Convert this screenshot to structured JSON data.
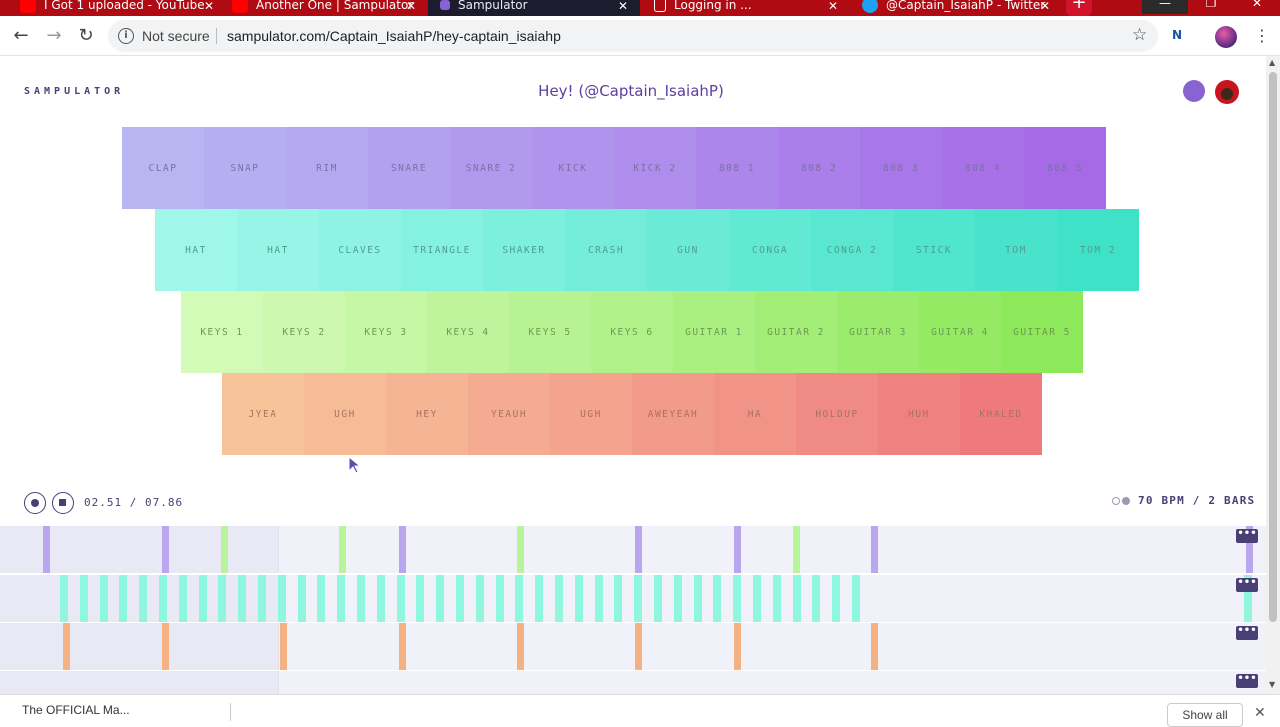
{
  "browser": {
    "tabs": [
      {
        "title": "I Got 1 uploaded - YouTube",
        "favicon_color": "#ff0000"
      },
      {
        "title": "Another One | Sampulator",
        "favicon_color": "#ff0000"
      },
      {
        "title": "Sampulator",
        "favicon_color": "#8a63d2",
        "active": true
      },
      {
        "title": "Logging in ...",
        "favicon_color": "#ffffff"
      },
      {
        "title": "@Captain_IsaiahP - Twitter",
        "favicon_color": "#1da1f2"
      }
    ],
    "address": {
      "secure_label": "Not secure",
      "url": "sampulator.com/Captain_IsaiahP/hey-captain_isaiahp"
    }
  },
  "header": {
    "logo": "SAMPULATOR",
    "title": "Hey! (@Captain_IsaiahP)"
  },
  "pads": {
    "rows": [
      {
        "name": "drums",
        "labels": [
          "CLAP",
          "SNAP",
          "RIM",
          "SNARE",
          "SNARE 2",
          "KICK",
          "KICK 2",
          "808 1",
          "808 2",
          "808 3",
          "808 4",
          "808 5"
        ],
        "from": "#b7b6f3",
        "to": "#a66ae6",
        "text": "#7d6fa8"
      },
      {
        "name": "percussion",
        "labels": [
          "HAT",
          "HAT",
          "CLAVES",
          "TRIANGLE",
          "SHAKER",
          "CRASH",
          "GUN",
          "CONGA",
          "CONGA 2",
          "STICK",
          "TOM",
          "TOM 2"
        ],
        "from": "#9ff7ea",
        "to": "#3fe1c7",
        "text": "#4e9e90"
      },
      {
        "name": "keys-guitar",
        "labels": [
          "KEYS 1",
          "KEYS 2",
          "KEYS 3",
          "KEYS 4",
          "KEYS 5",
          "KEYS 6",
          "GUITAR 1",
          "GUITAR 2",
          "GUITAR 3",
          "GUITAR 4",
          "GUITAR 5"
        ],
        "from": "#d3fbb8",
        "to": "#8de85a",
        "text": "#6d9a52"
      },
      {
        "name": "vocals",
        "labels": [
          "JYEA",
          "UGH",
          "HEY",
          "YEAUH",
          "UGH",
          "AWEYEAH",
          "HA",
          "HOLDUP",
          "HUH",
          "KHALED"
        ],
        "from": "#f7c49a",
        "to": "#ee7a7e",
        "text": "#a9735e"
      }
    ]
  },
  "transport": {
    "time": "02.51 / 07.86",
    "bpm": "70 BPM / 2 BARS"
  },
  "tracks": [
    {
      "name": "drums",
      "color": "#b9a6ee",
      "alt_color": "#b8f49a",
      "hits": [
        43,
        162,
        221,
        339,
        399,
        517,
        635,
        734,
        793,
        871,
        1246
      ]
    },
    {
      "name": "percussion",
      "color": "#8ff7df",
      "hits": "dense"
    },
    {
      "name": "vocals",
      "color": "#f3b184",
      "hits": [
        63,
        162,
        280,
        399,
        517,
        635,
        734,
        871
      ]
    },
    {
      "name": "extra",
      "color": "#b9a6ee",
      "hits": [
        695
      ]
    }
  ],
  "downloads": {
    "item": "The OFFICIAL Ma...",
    "show_all": "Show all"
  }
}
